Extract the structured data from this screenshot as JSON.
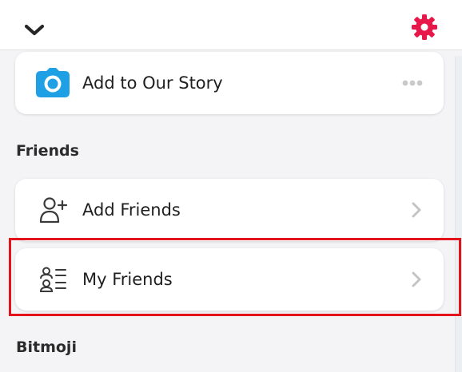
{
  "header": {
    "collapse_icon": "chevron-down-icon",
    "settings_icon": "gear-icon",
    "settings_color": "#e8174a"
  },
  "story": {
    "label": "Add to Our Story",
    "icon": "camera-icon",
    "icon_color": "#1fa0e5",
    "more_icon": "more-dots-icon"
  },
  "friends_section": {
    "heading": "Friends",
    "items": [
      {
        "label": "Add Friends",
        "icon": "add-friend-icon",
        "chevron": "chevron-right-icon"
      },
      {
        "label": "My Friends",
        "icon": "friends-list-icon",
        "chevron": "chevron-right-icon"
      }
    ]
  },
  "bitmoji_section": {
    "heading": "Bitmoji"
  },
  "highlight_color": "#e3121b"
}
